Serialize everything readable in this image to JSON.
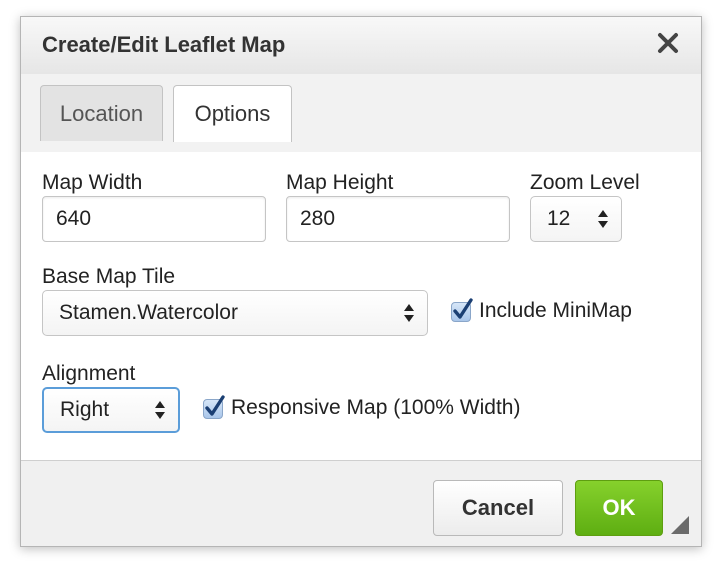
{
  "dialog": {
    "title": "Create/Edit Leaflet Map",
    "close_icon": "close-icon"
  },
  "tabs": [
    {
      "label": "Location",
      "active": false
    },
    {
      "label": "Options",
      "active": true
    }
  ],
  "form": {
    "map_width": {
      "label": "Map Width",
      "value": "640"
    },
    "map_height": {
      "label": "Map Height",
      "value": "280"
    },
    "zoom_level": {
      "label": "Zoom Level",
      "value": "12"
    },
    "base_map_tile": {
      "label": "Base Map Tile",
      "value": "Stamen.Watercolor"
    },
    "include_minimap": {
      "label": "Include MiniMap",
      "checked": true
    },
    "alignment": {
      "label": "Alignment",
      "value": "Right"
    },
    "responsive_map": {
      "label": "Responsive Map (100% Width)",
      "checked": true
    }
  },
  "footer": {
    "cancel_label": "Cancel",
    "ok_label": "OK"
  },
  "colors": {
    "ok_button": "#6cbf1c",
    "focus_ring": "#5b9dd9",
    "checkbox_fill": "#bcd4f0"
  }
}
